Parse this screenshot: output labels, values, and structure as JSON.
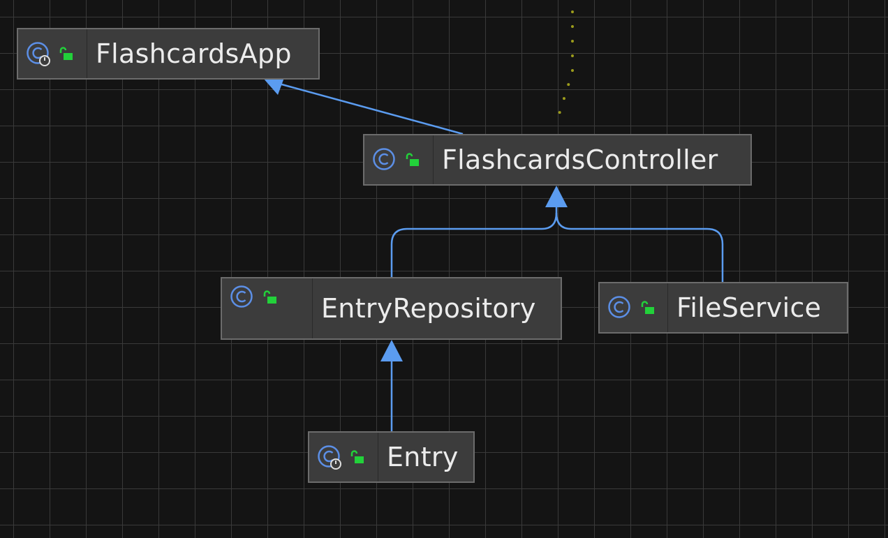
{
  "colors": {
    "background": "#141414",
    "grid": "#3a3a3a",
    "node_fill": "#3c3c3c",
    "node_border": "#6c6c6c",
    "text": "#ececec",
    "edge": "#5b9cf0",
    "class_icon": "#5c8fe6",
    "lock_icon": "#22d13a",
    "dotted_edge": "#9c9c1c"
  },
  "nodes": {
    "flashcards_app": {
      "name": "FlashcardsApp",
      "icon": "class-runnable-icon",
      "access": "public-lock-icon"
    },
    "flashcards_controller": {
      "name": "FlashcardsController",
      "icon": "class-icon",
      "access": "public-lock-icon"
    },
    "entry_repository": {
      "name": "EntryRepository",
      "icon": "class-icon",
      "access": "public-lock-icon"
    },
    "file_service": {
      "name": "FileService",
      "icon": "class-icon",
      "access": "public-lock-icon"
    },
    "entry": {
      "name": "Entry",
      "icon": "class-runnable-icon",
      "access": "public-lock-icon"
    }
  },
  "edges": [
    {
      "from": "flashcards_controller",
      "to": "flashcards_app",
      "style": "solid-arrow"
    },
    {
      "from": "entry_repository",
      "to": "flashcards_controller",
      "style": "solid-arrow"
    },
    {
      "from": "file_service",
      "to": "flashcards_controller",
      "style": "solid-arrow"
    },
    {
      "from": "entry",
      "to": "entry_repository",
      "style": "solid-arrow"
    },
    {
      "from": "offscreen",
      "to": "flashcards_controller",
      "style": "dotted"
    }
  ]
}
